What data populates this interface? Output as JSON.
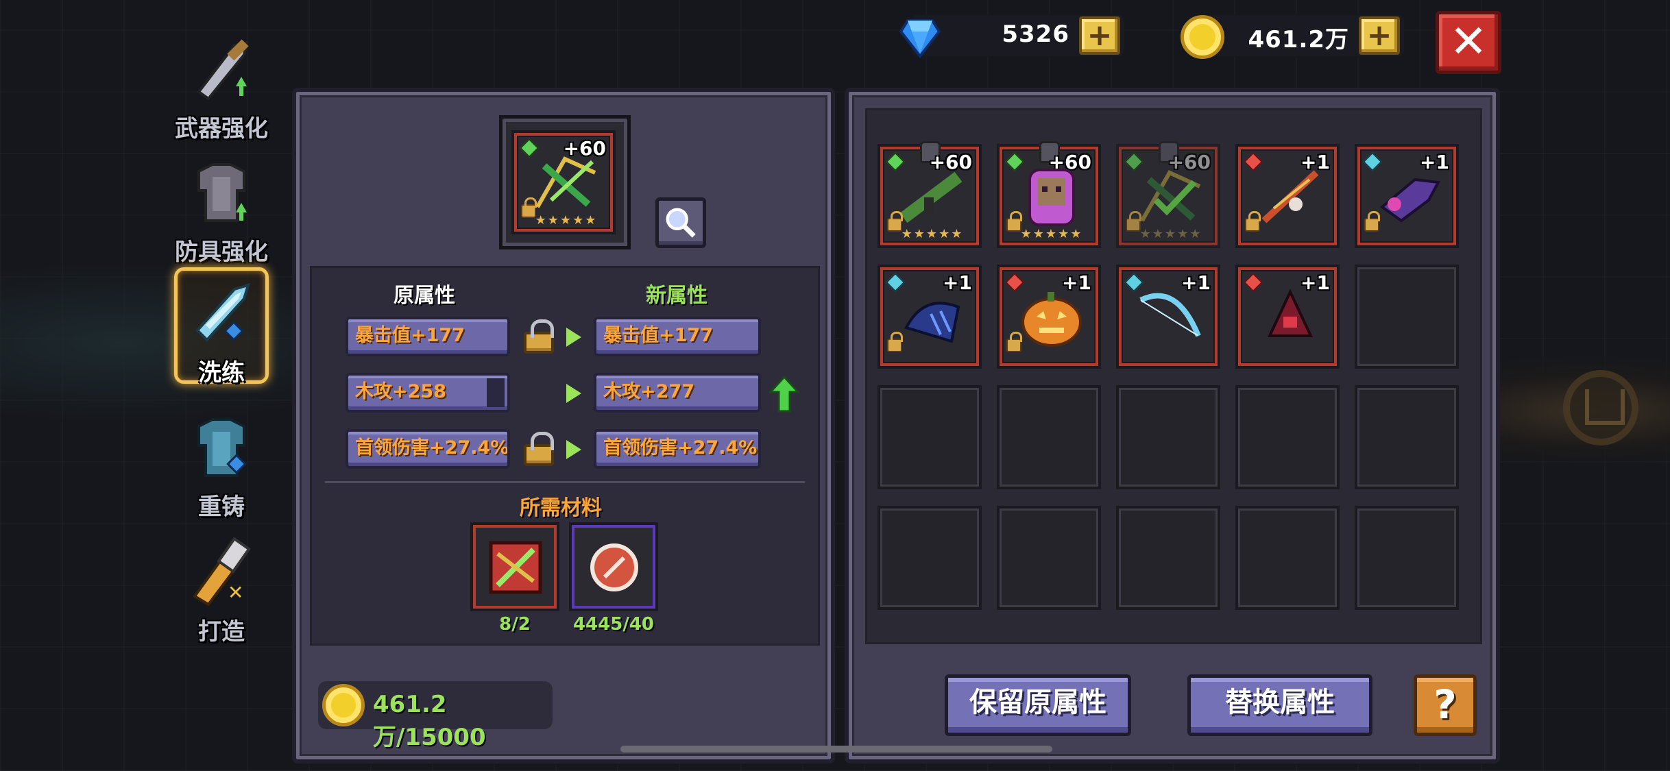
{
  "currency": {
    "gems": "5326",
    "gold": "461.2万"
  },
  "close_label": "✕",
  "nav": [
    {
      "label": "武器强化",
      "icon": "sword-upgrade-icon",
      "active": false
    },
    {
      "label": "防具强化",
      "icon": "armor-upgrade-icon",
      "active": false
    },
    {
      "label": "洗练",
      "icon": "reforge-sword-icon",
      "active": true
    },
    {
      "label": "重铸",
      "icon": "recast-armor-icon",
      "active": false
    },
    {
      "label": "打造",
      "icon": "forge-hammer-icon",
      "active": false
    }
  ],
  "selected_item": {
    "level": "+60",
    "gem_color": "#5fd35a",
    "stars": "★★★★★",
    "icon": "green-crossbow-icon"
  },
  "attributes": {
    "old_header": "原属性",
    "new_header": "新属性",
    "rows": [
      {
        "old": "暴击值+177",
        "new": "暴击值+177",
        "locked": true,
        "improved": false
      },
      {
        "old": "木攻+258",
        "new": "木攻+277",
        "locked": false,
        "improved": true
      },
      {
        "old": "首领伤害+27.4%",
        "new": "首领伤害+27.4%",
        "locked": true,
        "improved": false
      }
    ]
  },
  "materials": {
    "label": "所需材料",
    "items": [
      {
        "icon": "reforge-scroll-icon",
        "count": "8/2"
      },
      {
        "icon": "copper-disc-icon",
        "count": "4445/40"
      }
    ]
  },
  "gold_cost": "461.2万/15000",
  "inventory": [
    {
      "level": "+60",
      "gem_color": "#5fd35a",
      "stars": "★★★★★",
      "icon": "green-rocket-launcher-icon",
      "pinned": true,
      "dim": false
    },
    {
      "level": "+60",
      "gem_color": "#5fd35a",
      "stars": "★★★★★",
      "icon": "purple-ghost-armor-icon",
      "pinned": true,
      "dim": false
    },
    {
      "level": "+60",
      "gem_color": "#5fd35a",
      "stars": "★★★★★",
      "icon": "green-crossbow-icon",
      "pinned": true,
      "dim": true
    },
    {
      "level": "+1",
      "gem_color": "#e8504a",
      "stars": "",
      "icon": "fire-staff-icon",
      "pinned": false,
      "dim": false
    },
    {
      "level": "+1",
      "gem_color": "#5fd1e3",
      "stars": "",
      "icon": "purple-blaster-icon",
      "pinned": false,
      "dim": false
    },
    {
      "level": "+1",
      "gem_color": "#5fd1e3",
      "stars": "",
      "icon": "shadow-claw-icon",
      "pinned": false,
      "dim": false
    },
    {
      "level": "+1",
      "gem_color": "#e8504a",
      "stars": "",
      "icon": "pumpkin-icon",
      "pinned": false,
      "dim": false
    },
    {
      "level": "+1",
      "gem_color": "#5fd1e3",
      "stars": "",
      "icon": "ice-bow-icon",
      "pinned": false,
      "dim": false
    },
    {
      "level": "+1",
      "gem_color": "#e8504a",
      "stars": "",
      "icon": "red-witch-hat-icon",
      "pinned": false,
      "dim": false
    }
  ],
  "buttons": {
    "keep": "保留原属性",
    "replace": "替换属性",
    "help": "?"
  },
  "colors": {
    "accent_orange": "#ffa63a",
    "accent_green": "#9be35a",
    "button_purple": "#7471b6",
    "close_red": "#c9302c"
  }
}
